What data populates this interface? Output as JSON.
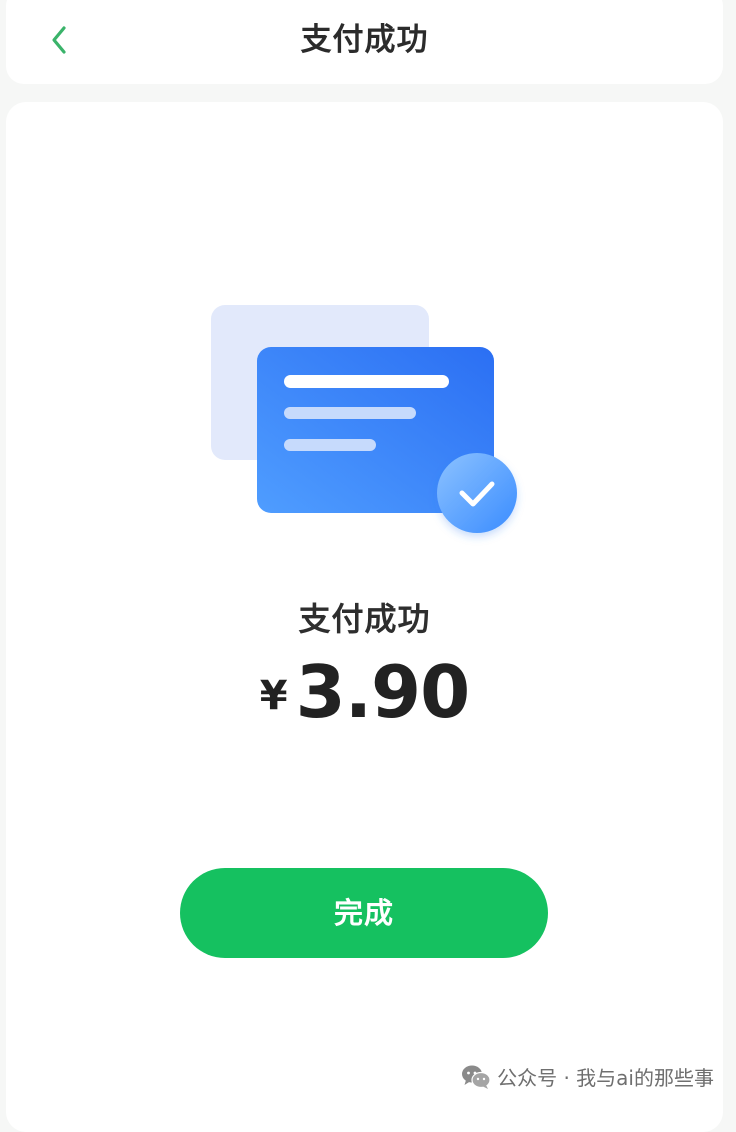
{
  "header": {
    "title": "支付成功",
    "back_icon": "chevron-left-icon",
    "accent_color": "#3ab36a"
  },
  "result": {
    "status_text": "支付成功",
    "currency_symbol": "¥",
    "amount": "3.90",
    "illustration_icon": "payment-success-illustration",
    "check_icon": "checkmark-icon"
  },
  "actions": {
    "done_label": "完成",
    "done_color": "#15c160"
  },
  "watermark": {
    "icon": "wechat-icon",
    "text": "公众号 · 我与ai的那些事"
  }
}
